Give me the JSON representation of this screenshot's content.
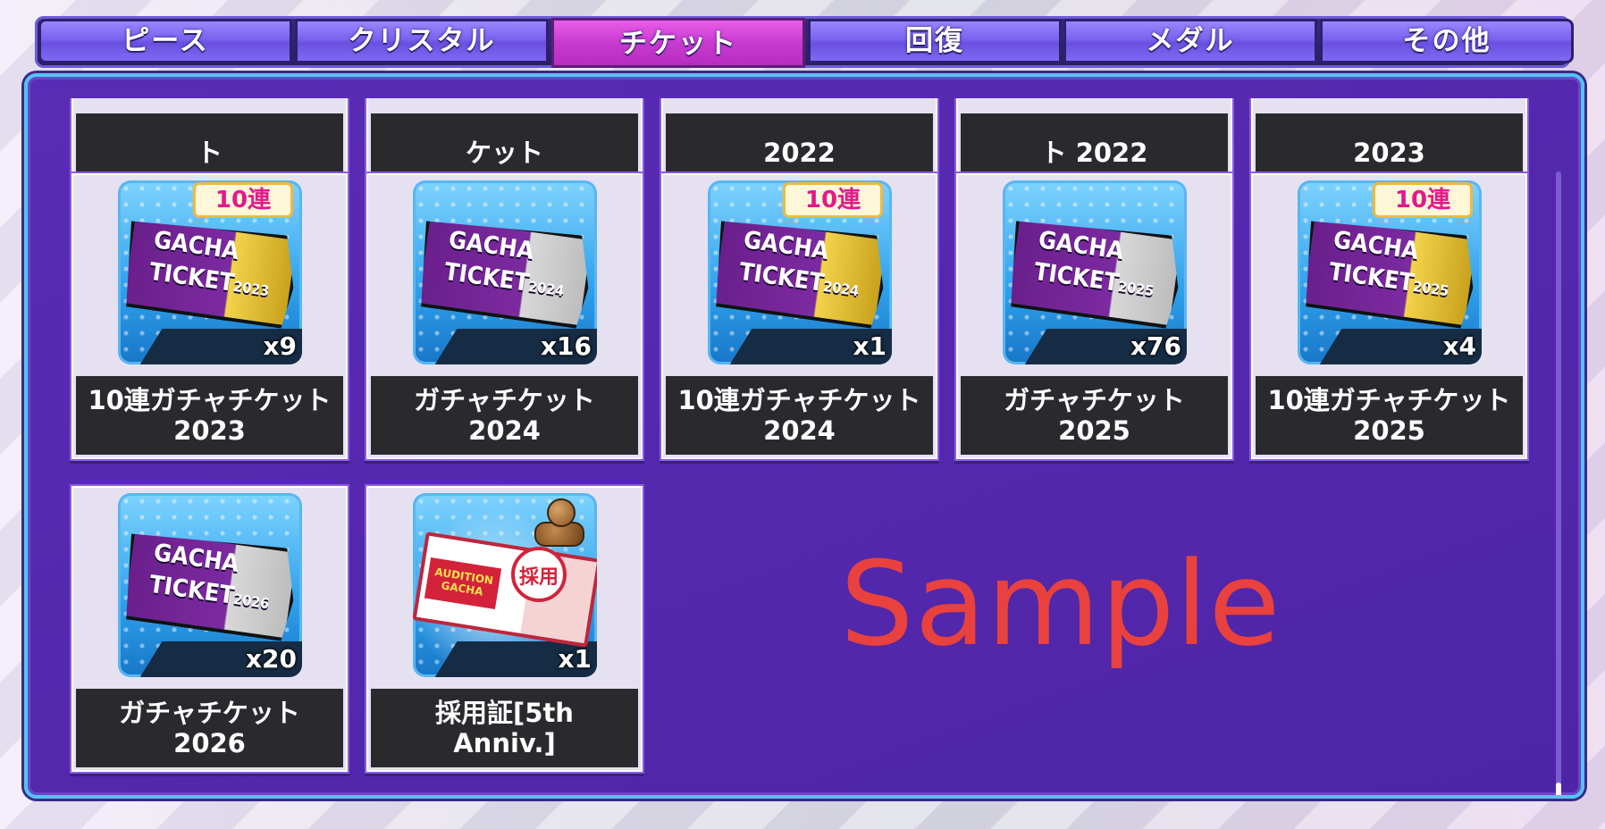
{
  "tabs": [
    {
      "label": "ピース"
    },
    {
      "label": "クリスタル"
    },
    {
      "label": "チケット"
    },
    {
      "label": "回復"
    },
    {
      "label": "メダル"
    },
    {
      "label": "その他"
    }
  ],
  "active_tab": "チケット",
  "top_row": [
    "ト",
    "ケット",
    "2022",
    "ト 2022",
    "2023"
  ],
  "items": [
    {
      "name": "10連ガチャチケット 2023",
      "qty": "x9",
      "badge": "10連",
      "ticket_title": "GACHA",
      "ticket_line2": "TICKET",
      "ticket_year": "2023",
      "style": "gold"
    },
    {
      "name": "ガチャチケット\n2024",
      "qty": "x16",
      "badge": "",
      "ticket_title": "GACHA",
      "ticket_line2": "TICKET",
      "ticket_year": "2024",
      "style": "silver"
    },
    {
      "name": "10連ガチャチケット 2024",
      "qty": "x1",
      "badge": "10連",
      "ticket_title": "GACHA",
      "ticket_line2": "TICKET",
      "ticket_year": "2024",
      "style": "gold"
    },
    {
      "name": "ガチャチケット\n2025",
      "qty": "x76",
      "badge": "",
      "ticket_title": "GACHA",
      "ticket_line2": "TICKET",
      "ticket_year": "2025",
      "style": "silver"
    },
    {
      "name": "10連ガチャチケット 2025",
      "qty": "x4",
      "badge": "10連",
      "ticket_title": "GACHA",
      "ticket_line2": "TICKET",
      "ticket_year": "2025",
      "style": "gold"
    },
    {
      "name": "ガチャチケット\n2026",
      "qty": "x20",
      "badge": "",
      "ticket_title": "GACHA",
      "ticket_line2": "TICKET",
      "ticket_year": "2026",
      "style": "silver"
    },
    {
      "name": "採用証[5th\nAnniv.]",
      "qty": "x1",
      "badge": "",
      "audition_text": "AUDITION GACHA",
      "stamp_text": "採用",
      "style": "audition"
    }
  ],
  "watermark": "Sample",
  "colors": {
    "panel": "#5428ad",
    "active_tab": "#c93bd0",
    "tab": "#7a63ee",
    "border": "#4fc6ef",
    "watermark": "#e8413e"
  }
}
